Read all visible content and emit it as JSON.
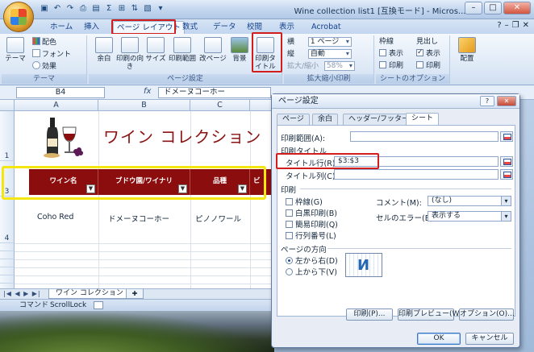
{
  "window": {
    "title": "Wine collection list1 [互換モード] - Micros..."
  },
  "qat_icons": [
    "save-icon",
    "undo-icon",
    "redo-icon",
    "print-icon",
    "chart-icon",
    "sum-icon",
    "table-icon",
    "sort-icon",
    "image-icon"
  ],
  "ribbon": {
    "tabs": [
      "ホーム",
      "挿入",
      "ページ レイアウト",
      "数式",
      "データ",
      "校閲",
      "表示",
      "Acrobat"
    ],
    "active_tab": "ページ レイアウト",
    "theme_group": {
      "label": "テーマ",
      "theme_button": "テーマ",
      "colors": "配色",
      "fonts": "フォント",
      "effects": "効果"
    },
    "page_setup_group": {
      "label": "ページ設定",
      "margins": "余白",
      "orientation": "印刷の向き",
      "size": "サイズ",
      "print_area": "印刷範囲",
      "breaks": "改ページ",
      "background": "背景",
      "print_titles": "印刷タイトル"
    },
    "scale_group": {
      "label": "拡大縮小印刷",
      "width_label": "横",
      "width_value": "1 ページ",
      "height_label": "縦",
      "height_value": "自動",
      "scale_label": "拡大/縮小",
      "scale_value": "58%"
    },
    "sheet_options_group": {
      "label": "シートのオプション",
      "gridlines": "枠線",
      "headings": "見出し",
      "view": "表示",
      "print": "印刷",
      "gridlines_view": false,
      "gridlines_print": false,
      "headings_view": true,
      "headings_print": false
    },
    "arrange_group": {
      "label": "配置"
    }
  },
  "formula_bar": {
    "name_box": "B4",
    "fx": "fx",
    "value": "ドメーヌコーホー"
  },
  "sheet": {
    "columns": [
      "A",
      "B",
      "C"
    ],
    "rows": [
      "1",
      "3",
      "4"
    ],
    "title": "ワイン コレクション",
    "header_cells": [
      "ワイン名",
      "ブドウ園/ワイナリ",
      "品種",
      "ビ"
    ],
    "data_row": [
      "Coho Red",
      "ドメーヌコーホー",
      "ピノノワール"
    ],
    "tab_name": "ワイン コレクション",
    "status": [
      "コマンド",
      "ScrollLock"
    ]
  },
  "dialog": {
    "title": "ページ設定",
    "tabs": [
      "ページ",
      "余白",
      "ヘッダー/フッター",
      "シート"
    ],
    "active_tab": "シート",
    "print_area_label": "印刷範囲(A):",
    "print_titles_label": "印刷タイトル",
    "rows_to_repeat_label": "タイトル行(R):",
    "rows_to_repeat_value": "$3:$3",
    "cols_to_repeat_label": "タイトル列(C):",
    "print_section_label": "印刷",
    "gridlines": "枠線(G)",
    "black_white": "白黒印刷(B)",
    "draft": "簡易印刷(Q)",
    "row_col_headings": "行列番号(L)",
    "comments_label": "コメント(M):",
    "comments_value": "(なし)",
    "cell_errors_label": "セルのエラー(E):",
    "cell_errors_value": "表示する",
    "page_order_label": "ページの方向",
    "down_then_over": "左から右(D)",
    "over_then_down": "上から下(V)",
    "print_button": "印刷(P)...",
    "preview_button": "印刷プレビュー(W)",
    "options_button": "オプション(O)...",
    "ok_button": "OK",
    "cancel_button": "キャンセル"
  }
}
